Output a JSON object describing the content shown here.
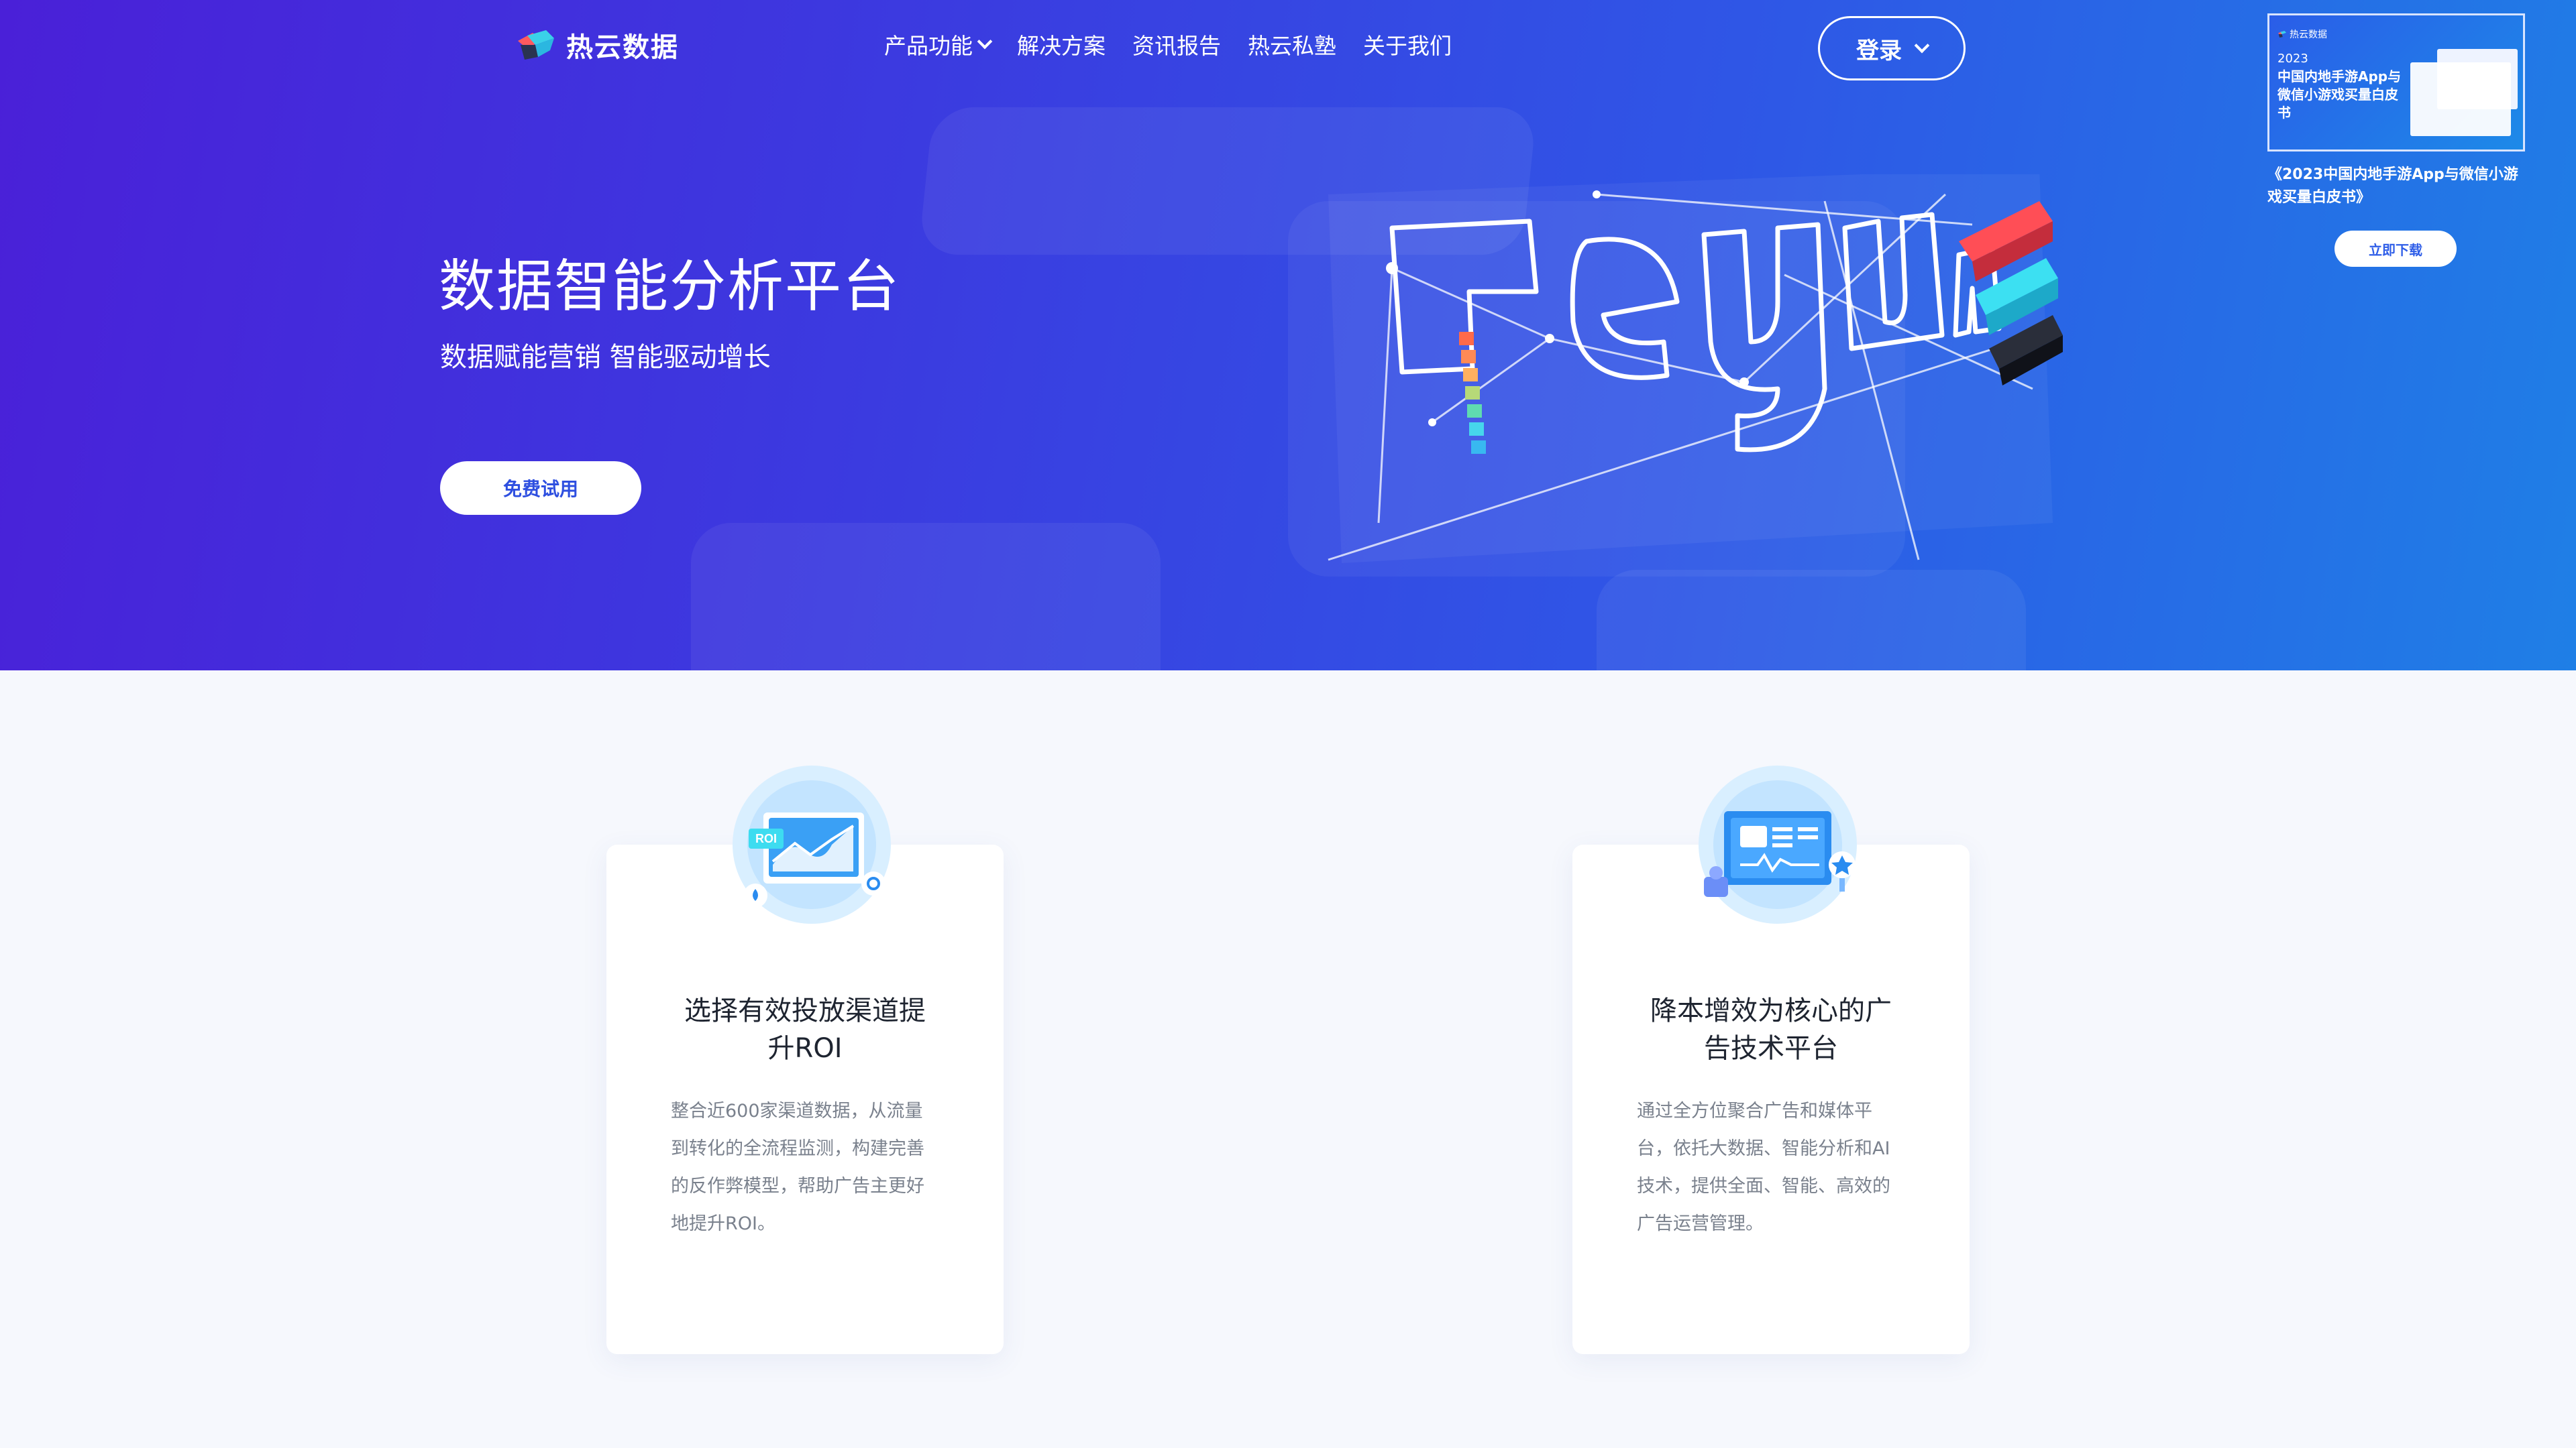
{
  "brand": {
    "name": "热云数据"
  },
  "nav": {
    "items": [
      {
        "label": "产品功能",
        "has_dropdown": true
      },
      {
        "label": "解决方案"
      },
      {
        "label": "资讯报告"
      },
      {
        "label": "热云私塾"
      },
      {
        "label": "关于我们"
      }
    ],
    "login_label": "登录"
  },
  "promo": {
    "thumb_brand": "热云数据",
    "thumb_year": "2023",
    "thumb_title": "中国内地手游App与微信小游戏买量白皮书",
    "caption": "《2023中国内地手游App与微信小游戏买量白皮书》",
    "button_label": "立即下载"
  },
  "hero": {
    "title": "数据智能分析平台",
    "subtitle": "数据赋能营销 智能驱动增长",
    "cta_label": "免费试用",
    "art_text": "reyun"
  },
  "cards": [
    {
      "icon": "roi-chart-icon",
      "badge": "ROI",
      "title": "选择有效投放渠道提升ROI",
      "description": "整合近600家渠道数据，从流量到转化的全流程监测，构建完善的反作弊模型，帮助广告主更好地提升ROI。"
    },
    {
      "icon": "ad-platform-icon",
      "title": "降本增效为核心的广告技术平台",
      "description": "通过全方位聚合广告和媒体平台，依托大数据、智能分析和AI技术，提供全面、智能、高效的广告运营管理。"
    }
  ],
  "colors": {
    "hero_start": "#4a20d8",
    "hero_end": "#1f7fe6",
    "accent": "#2e4fe0",
    "page_bg": "#f6f8fd"
  }
}
